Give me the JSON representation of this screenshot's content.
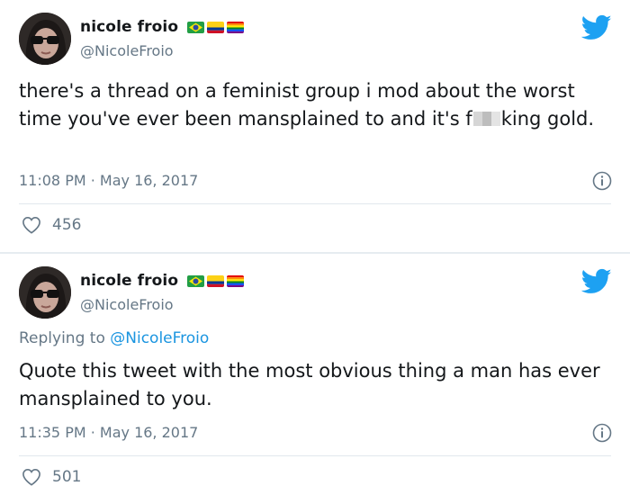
{
  "tweets": [
    {
      "display_name": "nicole froio",
      "handle": "@NicoleFroio",
      "text_before": "there's a thread on a feminist group i mod about the worst time you've ever been mansplained to and it's f",
      "text_after": "king gold.",
      "timestamp": "11:08 PM · May 16, 2017",
      "like_count": "456"
    },
    {
      "display_name": "nicole froio",
      "handle": "@NicoleFroio",
      "reply_prefix": "Replying to ",
      "reply_handle": "@NicoleFroio",
      "text": "Quote this tweet with the most obvious thing a man has ever mansplained to you.",
      "timestamp": "11:35 PM · May 16, 2017",
      "like_count": "501"
    }
  ],
  "colors": {
    "twitter_blue": "#1da1f2",
    "secondary_text": "#657786",
    "link": "#1b95e0",
    "divider": "#e1e8ed"
  },
  "icons": {
    "brand": "twitter-bird-icon",
    "info": "info-icon",
    "like": "heart-icon",
    "flags": [
      "brazil-flag-icon",
      "colombia-flag-icon",
      "rainbow-flag-icon"
    ]
  }
}
